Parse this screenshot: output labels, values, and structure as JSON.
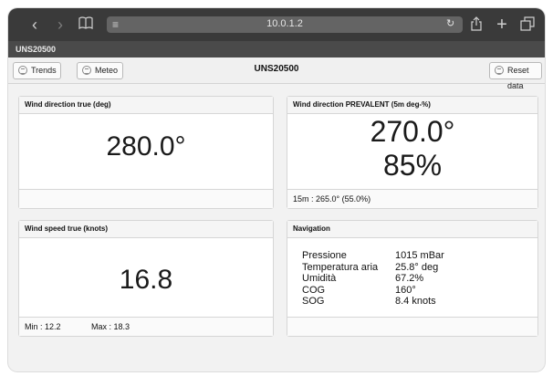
{
  "browser": {
    "url": "10.0.1.2",
    "tab_title": "UNS20500",
    "icons": [
      "back-icon",
      "forward-icon",
      "bookmarks-icon",
      "reader-icon",
      "reload-icon",
      "share-icon",
      "new-tab-icon",
      "tabs-icon"
    ]
  },
  "toolbar": {
    "trends_label": "Trends",
    "meteo_label": "Meteo",
    "title": "UNS20500",
    "reset_label": "Reset data"
  },
  "panels": {
    "wind_direction": {
      "header": "Wind direction true (deg)",
      "value": "280.0°"
    },
    "wind_prevalent": {
      "header": "Wind direction PREVALENT (5m deg-%)",
      "value": "270.0°",
      "percent": "85%",
      "footer": "15m : 265.0° (55.0%)"
    },
    "wind_speed": {
      "header": "Wind speed true (knots)",
      "value": "16.8",
      "min": "Min : 12.2",
      "max": "Max : 18.3"
    },
    "navigation": {
      "header": "Navigation",
      "rows": [
        {
          "label": "Pressione",
          "value": "1015 mBar"
        },
        {
          "label": "Temperatura aria",
          "value": "25.8° deg"
        },
        {
          "label": "Umidità",
          "value": "67.2%"
        },
        {
          "label": "COG",
          "value": "160°"
        },
        {
          "label": "SOG",
          "value": "8.4 knots"
        }
      ]
    }
  }
}
